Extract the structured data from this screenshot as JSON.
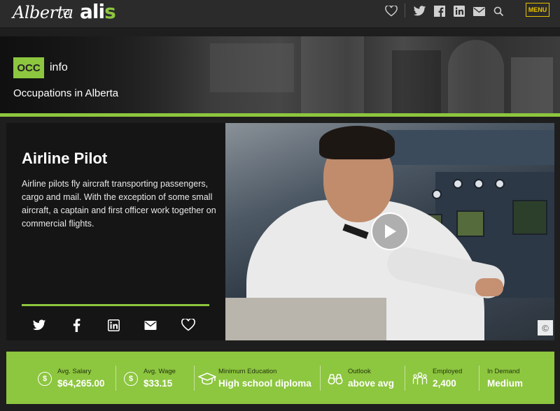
{
  "header": {
    "logo_alberta": "Alberta",
    "logo_alis_prefix": "ali",
    "logo_alis_suffix": "s",
    "menu_label": "MENU",
    "icons": [
      "heart-icon",
      "twitter-icon",
      "facebook-icon",
      "linkedin-icon",
      "mail-icon",
      "search-icon"
    ]
  },
  "banner": {
    "badge": "OCC",
    "badge_suffix": "info",
    "subtitle": "Occupations in Alberta"
  },
  "occupation": {
    "title": "Airline Pilot",
    "description": "Airline pilots fly aircraft transporting passengers, cargo and mail. With the exception of some small aircraft, a captain and first officer work together on commercial flights.",
    "share_icons": [
      "twitter-icon",
      "facebook-icon",
      "linkedin-icon",
      "mail-icon",
      "heart-icon"
    ]
  },
  "video": {
    "copyright_symbol": "©"
  },
  "stats": [
    {
      "label": "Avg. Salary",
      "value": "$64,265.00",
      "icon": "dollar-icon"
    },
    {
      "label": "Avg. Wage",
      "value": "$33.15",
      "icon": "dollar-icon"
    },
    {
      "label": "Minimum Education",
      "value": "High school diploma",
      "icon": "graduation-cap-icon"
    },
    {
      "label": "Outlook",
      "value": "above avg",
      "icon": "binoculars-icon"
    },
    {
      "label": "Employed",
      "value": "2,400",
      "icon": "people-icon"
    },
    {
      "label": "In Demand",
      "value": "Medium",
      "icon": ""
    }
  ],
  "colors": {
    "accent_green": "#8dc63f",
    "menu_yellow": "#e8c300",
    "header_bg": "#2b2b2b"
  }
}
